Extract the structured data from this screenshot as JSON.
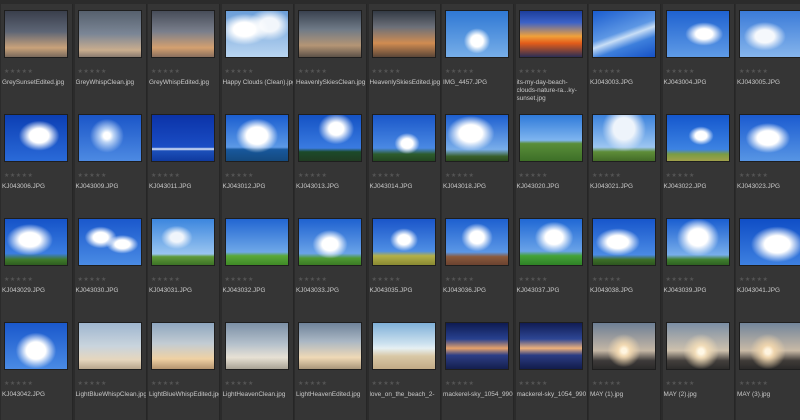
{
  "rating_glyphs": "★★★★★",
  "items": [
    {
      "name": "GreySunsetEdited.jpg",
      "thumb": "grey-sunset"
    },
    {
      "name": "GreyWhispClean.jpg",
      "thumb": "grey-whisp"
    },
    {
      "name": "GreyWhispEdited.jpg",
      "thumb": "grey-whisp-edited"
    },
    {
      "name": "Happy Clouds (Clean).jpg",
      "thumb": "happy-clouds"
    },
    {
      "name": "HeavenlySkiesClean.jpg",
      "thumb": "heavenly-skies"
    },
    {
      "name": "HeavenlySkiesEdited.jpg",
      "thumb": "heavenly-skies-edited"
    },
    {
      "name": "IMG_4457.JPG",
      "thumb": "blue-sky"
    },
    {
      "name": "its-my-day-beach-clouds-nature-ra...ky-sunset.jpg",
      "thumb": "vivid-sunset"
    },
    {
      "name": "KJ043003.JPG",
      "thumb": "blue-streak"
    },
    {
      "name": "KJ043004.JPG",
      "thumb": "blue-clouds"
    },
    {
      "name": "KJ043005.JPG",
      "thumb": "blue-clouds-light"
    },
    {
      "name": "KJ043006.JPG",
      "thumb": "deep-blue-clouds"
    },
    {
      "name": "KJ043009.JPG",
      "thumb": "sun-burst"
    },
    {
      "name": "KJ043011.JPG",
      "thumb": "deep-blue-sea"
    },
    {
      "name": "KJ043012.JPG",
      "thumb": "big-cloud-sea"
    },
    {
      "name": "KJ043013.JPG",
      "thumb": "trees-sky"
    },
    {
      "name": "KJ043014.JPG",
      "thumb": "tree-sky"
    },
    {
      "name": "KJ043018.JPG",
      "thumb": "cloud-tree"
    },
    {
      "name": "KJ043020.JPG",
      "thumb": "field-sky"
    },
    {
      "name": "KJ043021.JPG",
      "thumb": "wide-sky-field"
    },
    {
      "name": "KJ043022.JPG",
      "thumb": "single-cloud"
    },
    {
      "name": "KJ043023.JPG",
      "thumb": "puffy-clouds"
    },
    {
      "name": "KJ043029.JPG",
      "thumb": "cumulus-field"
    },
    {
      "name": "KJ043030.JPG",
      "thumb": "scattered-clouds"
    },
    {
      "name": "KJ043031.JPG",
      "thumb": "field-horizon"
    },
    {
      "name": "KJ043032.JPG",
      "thumb": "green-field"
    },
    {
      "name": "KJ043033.JPG",
      "thumb": "cloud-row"
    },
    {
      "name": "KJ043035.JPG",
      "thumb": "yellow-field"
    },
    {
      "name": "KJ043036.JPG",
      "thumb": "brown-field"
    },
    {
      "name": "KJ043037.JPG",
      "thumb": "green-meadow"
    },
    {
      "name": "KJ043038.JPG",
      "thumb": "tall-cloud"
    },
    {
      "name": "KJ043039.JPG",
      "thumb": "cloud-band"
    },
    {
      "name": "KJ043041.JPG",
      "thumb": "towering-cumulus"
    },
    {
      "name": "KJ043042.JPG",
      "thumb": "cumulus-tall"
    },
    {
      "name": "LightBlueWhispClean.jpg",
      "thumb": "light-whisp"
    },
    {
      "name": "LightBlueWhispEdited.jpg",
      "thumb": "light-whisp-edited"
    },
    {
      "name": "LightHeavenClean.jpg",
      "thumb": "light-heaven"
    },
    {
      "name": "LightHeavenEdited.jpg",
      "thumb": "light-heaven-edited"
    },
    {
      "name": "love_on_the_beach_2-",
      "thumb": "beach-couple"
    },
    {
      "name": "mackerel-sky_1054_990",
      "thumb": "mackerel-sky"
    },
    {
      "name": "mackerel-sky_1054_990",
      "thumb": "mackerel-sky-2"
    },
    {
      "name": "MAY (1).jpg",
      "thumb": "may-sun"
    },
    {
      "name": "MAY (2).jpg",
      "thumb": "may-sun-2"
    },
    {
      "name": "MAY (3).jpg",
      "thumb": "may-sun-3"
    }
  ]
}
